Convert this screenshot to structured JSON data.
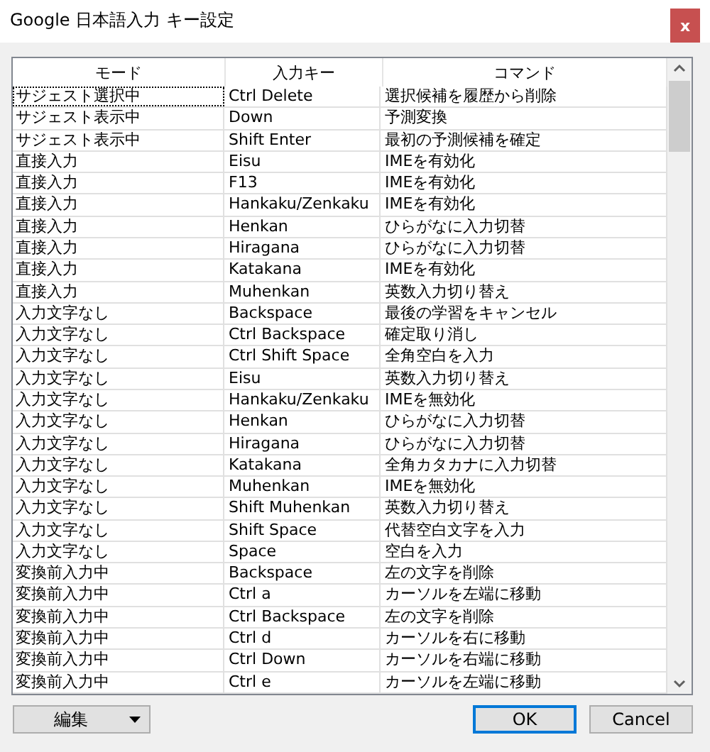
{
  "window": {
    "title": "Google 日本語入力 キー設定",
    "close": "x"
  },
  "table": {
    "columns": [
      "モード",
      "入力キー",
      "コマンド"
    ],
    "rows": [
      {
        "cells": [
          "サジェスト選択中",
          "Ctrl Delete",
          "選択候補を履歴から削除"
        ],
        "focused": true
      },
      {
        "cells": [
          "サジェスト表示中",
          "Down",
          "予測変換"
        ],
        "focused": false
      },
      {
        "cells": [
          "サジェスト表示中",
          "Shift Enter",
          "最初の予測候補を確定"
        ],
        "focused": false
      },
      {
        "cells": [
          "直接入力",
          "Eisu",
          "IMEを有効化"
        ],
        "focused": false
      },
      {
        "cells": [
          "直接入力",
          "F13",
          "IMEを有効化"
        ],
        "focused": false
      },
      {
        "cells": [
          "直接入力",
          "Hankaku/Zenkaku",
          "IMEを有効化"
        ],
        "focused": false
      },
      {
        "cells": [
          "直接入力",
          "Henkan",
          "ひらがなに入力切替"
        ],
        "focused": false
      },
      {
        "cells": [
          "直接入力",
          "Hiragana",
          "ひらがなに入力切替"
        ],
        "focused": false
      },
      {
        "cells": [
          "直接入力",
          "Katakana",
          "IMEを有効化"
        ],
        "focused": false
      },
      {
        "cells": [
          "直接入力",
          "Muhenkan",
          "英数入力切り替え"
        ],
        "focused": false
      },
      {
        "cells": [
          "入力文字なし",
          "Backspace",
          "最後の学習をキャンセル"
        ],
        "focused": false
      },
      {
        "cells": [
          "入力文字なし",
          "Ctrl Backspace",
          "確定取り消し"
        ],
        "focused": false
      },
      {
        "cells": [
          "入力文字なし",
          "Ctrl Shift Space",
          "全角空白を入力"
        ],
        "focused": false
      },
      {
        "cells": [
          "入力文字なし",
          "Eisu",
          "英数入力切り替え"
        ],
        "focused": false
      },
      {
        "cells": [
          "入力文字なし",
          "Hankaku/Zenkaku",
          "IMEを無効化"
        ],
        "focused": false
      },
      {
        "cells": [
          "入力文字なし",
          "Henkan",
          "ひらがなに入力切替"
        ],
        "focused": false
      },
      {
        "cells": [
          "入力文字なし",
          "Hiragana",
          "ひらがなに入力切替"
        ],
        "focused": false
      },
      {
        "cells": [
          "入力文字なし",
          "Katakana",
          "全角カタカナに入力切替"
        ],
        "focused": false
      },
      {
        "cells": [
          "入力文字なし",
          "Muhenkan",
          "IMEを無効化"
        ],
        "focused": false
      },
      {
        "cells": [
          "入力文字なし",
          "Shift Muhenkan",
          "英数入力切り替え"
        ],
        "focused": false
      },
      {
        "cells": [
          "入力文字なし",
          "Shift Space",
          "代替空白文字を入力"
        ],
        "focused": false
      },
      {
        "cells": [
          "入力文字なし",
          "Space",
          "空白を入力"
        ],
        "focused": false
      },
      {
        "cells": [
          "変換前入力中",
          "Backspace",
          "左の文字を削除"
        ],
        "focused": false
      },
      {
        "cells": [
          "変換前入力中",
          "Ctrl a",
          "カーソルを左端に移動"
        ],
        "focused": false
      },
      {
        "cells": [
          "変換前入力中",
          "Ctrl Backspace",
          "左の文字を削除"
        ],
        "focused": false
      },
      {
        "cells": [
          "変換前入力中",
          "Ctrl d",
          "カーソルを右に移動"
        ],
        "focused": false
      },
      {
        "cells": [
          "変換前入力中",
          "Ctrl Down",
          "カーソルを右端に移動"
        ],
        "focused": false
      },
      {
        "cells": [
          "変換前入力中",
          "Ctrl e",
          "カーソルを左端に移動"
        ],
        "focused": false
      }
    ]
  },
  "buttons": [
    {
      "label": "編集",
      "kind": "dropdown",
      "default": false
    },
    {
      "label": "OK",
      "kind": "push",
      "default": true
    },
    {
      "label": "Cancel",
      "kind": "push",
      "default": false
    }
  ]
}
